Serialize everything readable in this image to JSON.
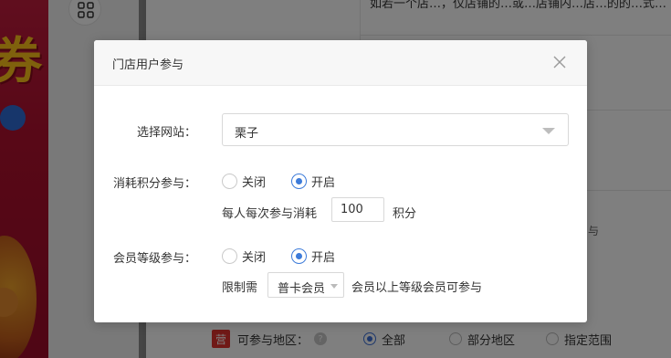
{
  "background": {
    "top_text": "如若一个店…，仅店铺的…或…店铺内…店…的的…式…",
    "side_hint": "与",
    "region_row": {
      "badge": "营",
      "label": "可参与地区：",
      "help": "?",
      "options": [
        {
          "label": "全部",
          "selected": true
        },
        {
          "label": "部分地区",
          "selected": false
        },
        {
          "label": "指定范围",
          "selected": false
        }
      ]
    }
  },
  "modal": {
    "title": "门店用户参与",
    "site": {
      "label": "选择网站：",
      "value": "栗子"
    },
    "points": {
      "label": "消耗积分参与：",
      "options": [
        {
          "label": "关闭",
          "selected": false
        },
        {
          "label": "开启",
          "selected": true
        }
      ],
      "prefix": "每人每次参与消耗",
      "value": "100",
      "suffix": "积分"
    },
    "member": {
      "label": "会员等级参与：",
      "options": [
        {
          "label": "关闭",
          "selected": false
        },
        {
          "label": "开启",
          "selected": true
        }
      ],
      "prefix": "限制需",
      "level": "普卡会员",
      "suffix": "会员以上等级会员可参与"
    }
  },
  "colors": {
    "accent": "#3d7bd9",
    "overlay": "rgba(0,0,0,0.5)",
    "banner": "#c11c3d"
  }
}
